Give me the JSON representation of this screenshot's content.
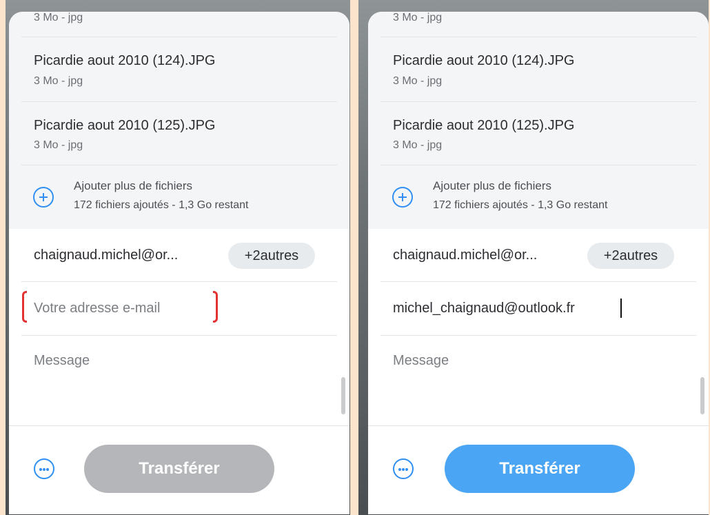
{
  "panels": [
    {
      "files": {
        "partial_meta": "3 Mo - jpg",
        "items": [
          {
            "name": "Picardie aout 2010 (124).JPG",
            "meta": "3 Mo - jpg"
          },
          {
            "name": "Picardie aout 2010 (125).JPG",
            "meta": "3 Mo - jpg"
          }
        ],
        "add_more_label": "Ajouter plus de fichiers",
        "add_more_summary": "172 fichiers ajoutés - 1,3 Go restant"
      },
      "recipient": {
        "email": "chaignaud.michel@or...",
        "others_chip": "+2autres"
      },
      "sender": {
        "value": "",
        "placeholder": "Votre adresse e-mail"
      },
      "message": {
        "placeholder": "Message"
      },
      "transfer_button": {
        "label": "Transférer",
        "enabled": false
      }
    },
    {
      "files": {
        "partial_meta": "3 Mo - jpg",
        "items": [
          {
            "name": "Picardie aout 2010 (124).JPG",
            "meta": "3 Mo - jpg"
          },
          {
            "name": "Picardie aout 2010 (125).JPG",
            "meta": "3 Mo - jpg"
          }
        ],
        "add_more_label": "Ajouter plus de fichiers",
        "add_more_summary": "172 fichiers ajoutés - 1,3 Go restant"
      },
      "recipient": {
        "email": "chaignaud.michel@or...",
        "others_chip": "+2autres"
      },
      "sender": {
        "value": "michel_chaignaud@outlook.fr",
        "placeholder": "Votre adresse e-mail"
      },
      "message": {
        "placeholder": "Message"
      },
      "transfer_button": {
        "label": "Transférer",
        "enabled": true
      }
    }
  ],
  "icons": {
    "add": "plus-circle-icon",
    "more": "more-options-icon"
  },
  "colors": {
    "accent": "#2f8ff2",
    "button_enabled": "#4aa5f5",
    "button_disabled": "#b4b6b9",
    "highlight_bracket": "#e23232",
    "background": "#fbe3cc"
  }
}
